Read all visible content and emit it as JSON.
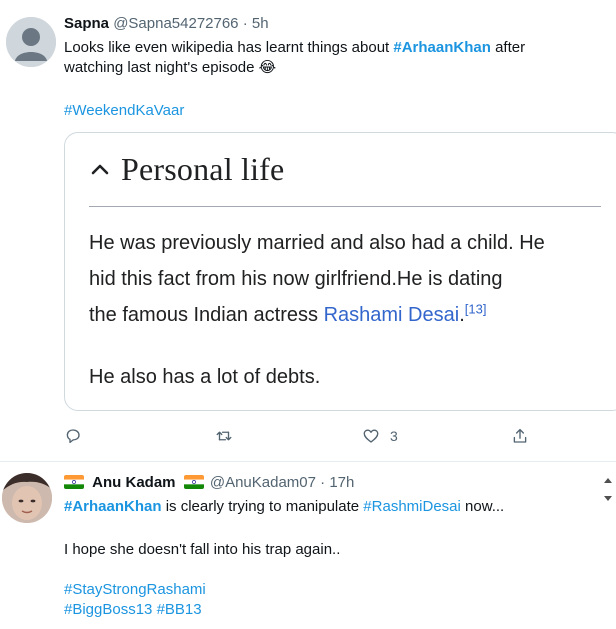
{
  "tweet1": {
    "name": "Sapna",
    "handle": "@Sapna54272766",
    "separator": " · ",
    "time": "5h",
    "text_before": "Looks like even wikipedia has learnt things about ",
    "text_hashtag": "#ArhaanKhan",
    "text_after": " after",
    "text_line2": "watching last night's episode ",
    "emoji": "😂",
    "hashtag_line": "#WeekendKaVaar",
    "card": {
      "heading": "Personal life",
      "para1_line1": "He was previously married and also had a child. He",
      "para1_line2": "hid this fact from his now girlfriend.He is dating",
      "para1_line3_before": "the famous Indian actress ",
      "para1_link": "Rashami Desai",
      "para1_period": ".",
      "para1_cite": "[13]",
      "para2": "He also has a lot of debts."
    },
    "actions": {
      "reply_count": "",
      "retweet_count": "",
      "like_count": "3",
      "share_count": ""
    }
  },
  "tweet2": {
    "name": "Anu Kadam",
    "handle": "@AnuKadam07",
    "separator": " · ",
    "time": "17h",
    "line1_hashtag1": "#ArhaanKhan",
    "line1_middle": " is clearly trying to manipulate ",
    "line1_hashtag2": "#RashmiDesai",
    "line1_end": " now...",
    "line2": "I hope she doesn't fall into his trap again..",
    "hashtag_line1": "#StayStrongRashami",
    "hashtag_line2a": "#BiggBoss13",
    "hashtag_line2b": "#BB13"
  },
  "colors": {
    "link": "#1b95e0",
    "wiki_link": "#3366cc",
    "meta": "#536471",
    "border": "#cfd9de"
  }
}
